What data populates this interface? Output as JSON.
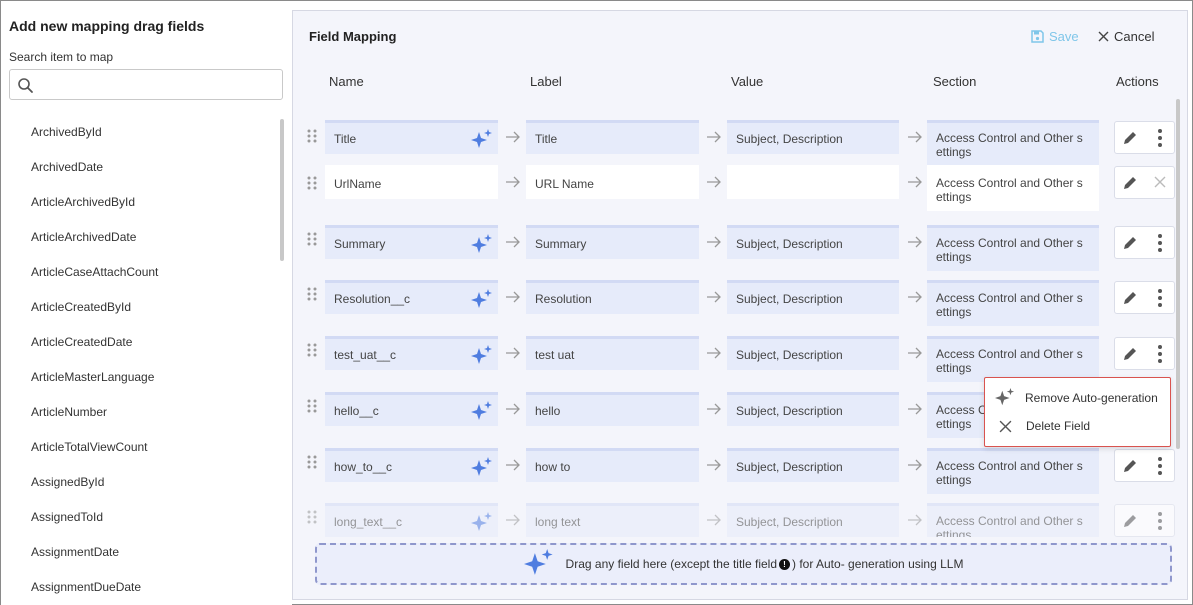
{
  "left_panel": {
    "title": "Add new mapping drag fields",
    "search_label": "Search item to map",
    "search_placeholder": "",
    "fields": [
      "ArchivedById",
      "ArchivedDate",
      "ArticleArchivedById",
      "ArticleArchivedDate",
      "ArticleCaseAttachCount",
      "ArticleCreatedById",
      "ArticleCreatedDate",
      "ArticleMasterLanguage",
      "ArticleNumber",
      "ArticleTotalViewCount",
      "AssignedById",
      "AssignedToId",
      "AssignmentDate",
      "AssignmentDueDate"
    ]
  },
  "mapping": {
    "title": "Field Mapping",
    "save_label": "Save",
    "cancel_label": "Cancel",
    "columns": {
      "name": "Name",
      "label": "Label",
      "value": "Value",
      "section": "Section",
      "actions": "Actions"
    },
    "rows": [
      {
        "name": "Title",
        "label": "Title",
        "value": "Subject, Description",
        "section": "Access Control and Other s ettings"
      },
      {
        "name": "UrlName",
        "label": "URL Name",
        "value": "",
        "section": "Access Control and Other s ettings"
      },
      {
        "name": "Summary",
        "label": "Summary",
        "value": "Subject, Description",
        "section": "Access Control and Other s ettings"
      },
      {
        "name": "Resolution__c",
        "label": "Resolution",
        "value": "Subject, Description",
        "section": "Access Control and Other s ettings"
      },
      {
        "name": "test_uat__c",
        "label": "test uat",
        "value": "Subject, Description",
        "section": "Access Control and Other s ettings"
      },
      {
        "name": "hello__c",
        "label": "hello",
        "value": "Subject, Description",
        "section": "Access Control and Other s ettings"
      },
      {
        "name": "how_to__c",
        "label": "how to",
        "value": "Subject, Description",
        "section": "Access Control and Other s ettings"
      },
      {
        "name": "long_text__c",
        "label": "long text",
        "value": "Subject, Description",
        "section": "Access Control and Other s ettings"
      }
    ],
    "drop_zone_text_before": "Drag any field here (except the title field",
    "drop_zone_info_glyph": "!",
    "drop_zone_text_after": ") for Auto- generation using LLM"
  },
  "context_menu": {
    "remove_autogen_label": "Remove Auto-generation",
    "delete_field_label": "Delete Field"
  },
  "colors": {
    "accent_save": "#7fc6e9",
    "sparkle": "#4f7de0",
    "cell_bg": "#e6ebfa",
    "menu_border": "#d9534f"
  }
}
